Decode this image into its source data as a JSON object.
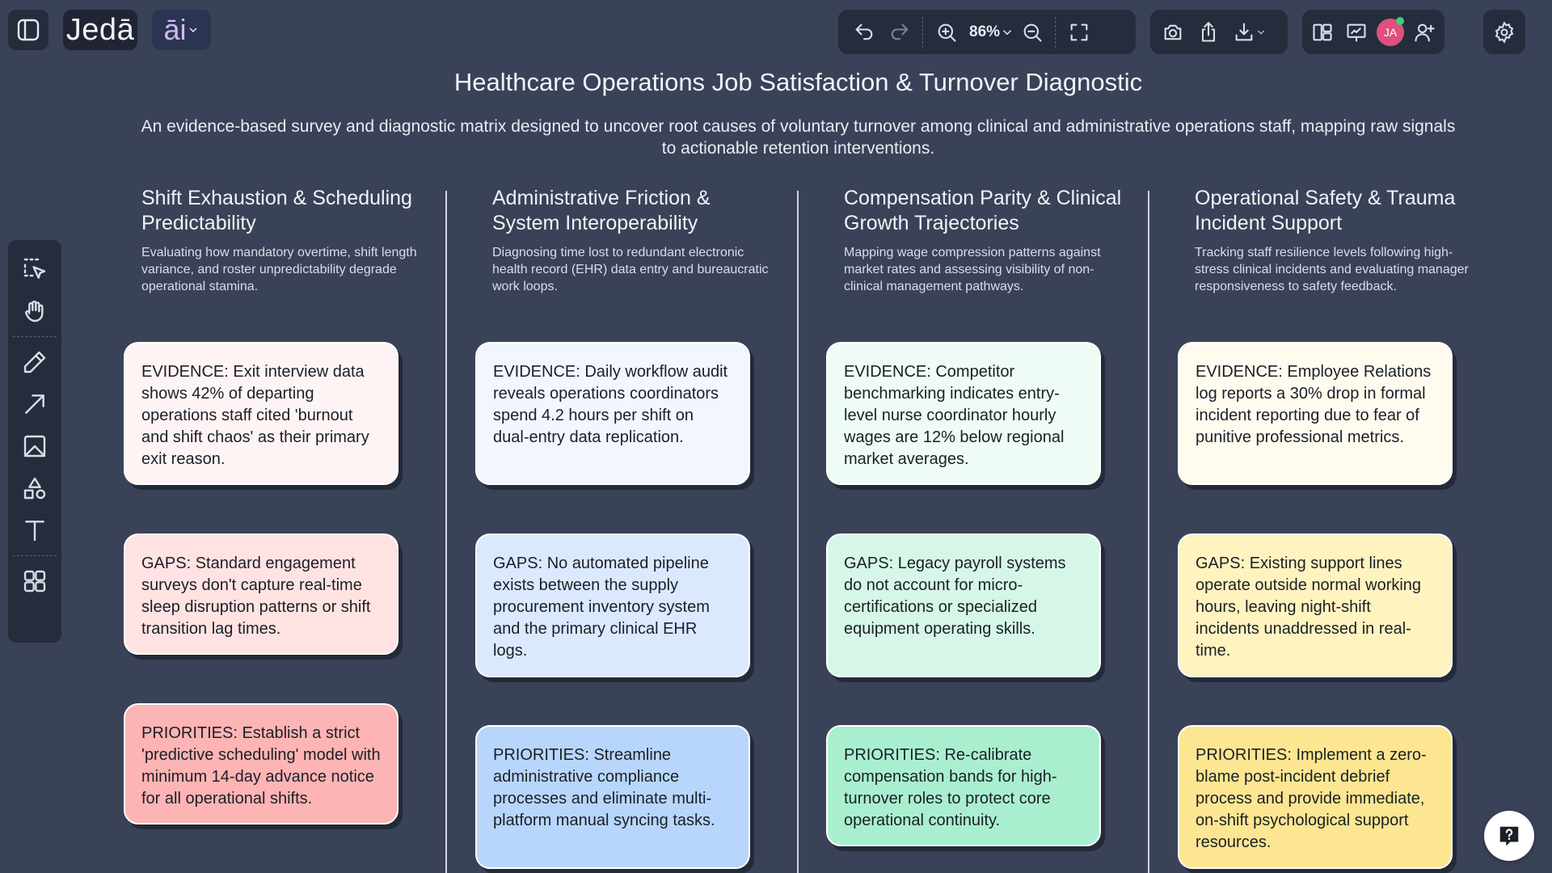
{
  "app": {
    "logo": "Jedā",
    "ai_label": "āi"
  },
  "toolbar": {
    "zoom": "86%",
    "avatar_initials": "JA"
  },
  "page": {
    "title": "Healthcare Operations Job Satisfaction & Turnover Diagnostic",
    "subtitle": "An evidence-based survey and diagnostic matrix designed to uncover root causes of voluntary turnover among clinical and administrative operations staff, mapping raw signals to actionable retention interventions."
  },
  "columns": [
    {
      "title": "Shift Exhaustion & Scheduling Predictability",
      "description": "Evaluating how mandatory overtime, shift length variance, and roster unpredictability degrade operational stamina.",
      "evidence": "EVIDENCE: Exit interview data shows 42% of departing operations staff cited 'burnout and shift chaos' as their primary exit reason.",
      "gaps": "GAPS: Standard engagement surveys don't capture real-time sleep disruption patterns or shift transition lag times.",
      "priorities": "PRIORITIES: Establish a strict 'predictive scheduling' model with minimum 14-day advance notice for all operational shifts.",
      "colors": [
        "#fff4f4",
        "#ffe3e3",
        "#fdb4b4"
      ]
    },
    {
      "title": "Administrative Friction & System Interoperability",
      "description": "Diagnosing time lost to redundant electronic health record (EHR) data entry and bureaucratic work loops.",
      "evidence": "EVIDENCE: Daily workflow audit reveals operations coordinators spend 4.2 hours per shift on dual-entry data replication.",
      "gaps": "GAPS: No automated pipeline exists between the supply procurement inventory system and the primary clinical EHR logs.",
      "priorities": "PRIORITIES: Streamline administrative compliance processes and eliminate multi-platform manual syncing tasks.",
      "colors": [
        "#f1f6ff",
        "#dbe9ff",
        "#b8d6fb"
      ]
    },
    {
      "title": "Compensation Parity & Clinical Growth Trajectories",
      "description": "Mapping wage compression patterns against market rates and assessing visibility of non-clinical management pathways.",
      "evidence": "EVIDENCE: Competitor benchmarking indicates entry-level nurse coordinator hourly wages are 12% below regional market averages.",
      "gaps": "GAPS: Legacy payroll systems do not account for micro-certifications or specialized equipment operating skills.",
      "priorities": "PRIORITIES: Re-calibrate compensation bands for high-turnover roles to protect core operational continuity.",
      "colors": [
        "#eefcf5",
        "#d6f7e7",
        "#a9efcf"
      ]
    },
    {
      "title": "Operational Safety & Trauma Incident Support",
      "description": "Tracking staff resilience levels following high-stress clinical incidents and evaluating manager responsiveness to safety feedback.",
      "evidence": "EVIDENCE: Employee Relations log reports a 30% drop in formal incident reporting due to fear of punitive professional metrics.",
      "gaps": "GAPS: Existing support lines operate outside normal working hours, leaving night-shift incidents unaddressed in real-time.",
      "priorities": "PRIORITIES: Implement a zero-blame post-incident debrief process and provide immediate, on-shift psychological support resources.",
      "colors": [
        "#fffbef",
        "#fff3bf",
        "#fde691"
      ]
    }
  ],
  "icons": {
    "left_rail": [
      "select-icon",
      "hand-icon",
      "pencil-icon",
      "arrow-icon",
      "image-icon",
      "shapes-icon",
      "text-icon",
      "grid-icon"
    ],
    "help": "help-icon"
  }
}
